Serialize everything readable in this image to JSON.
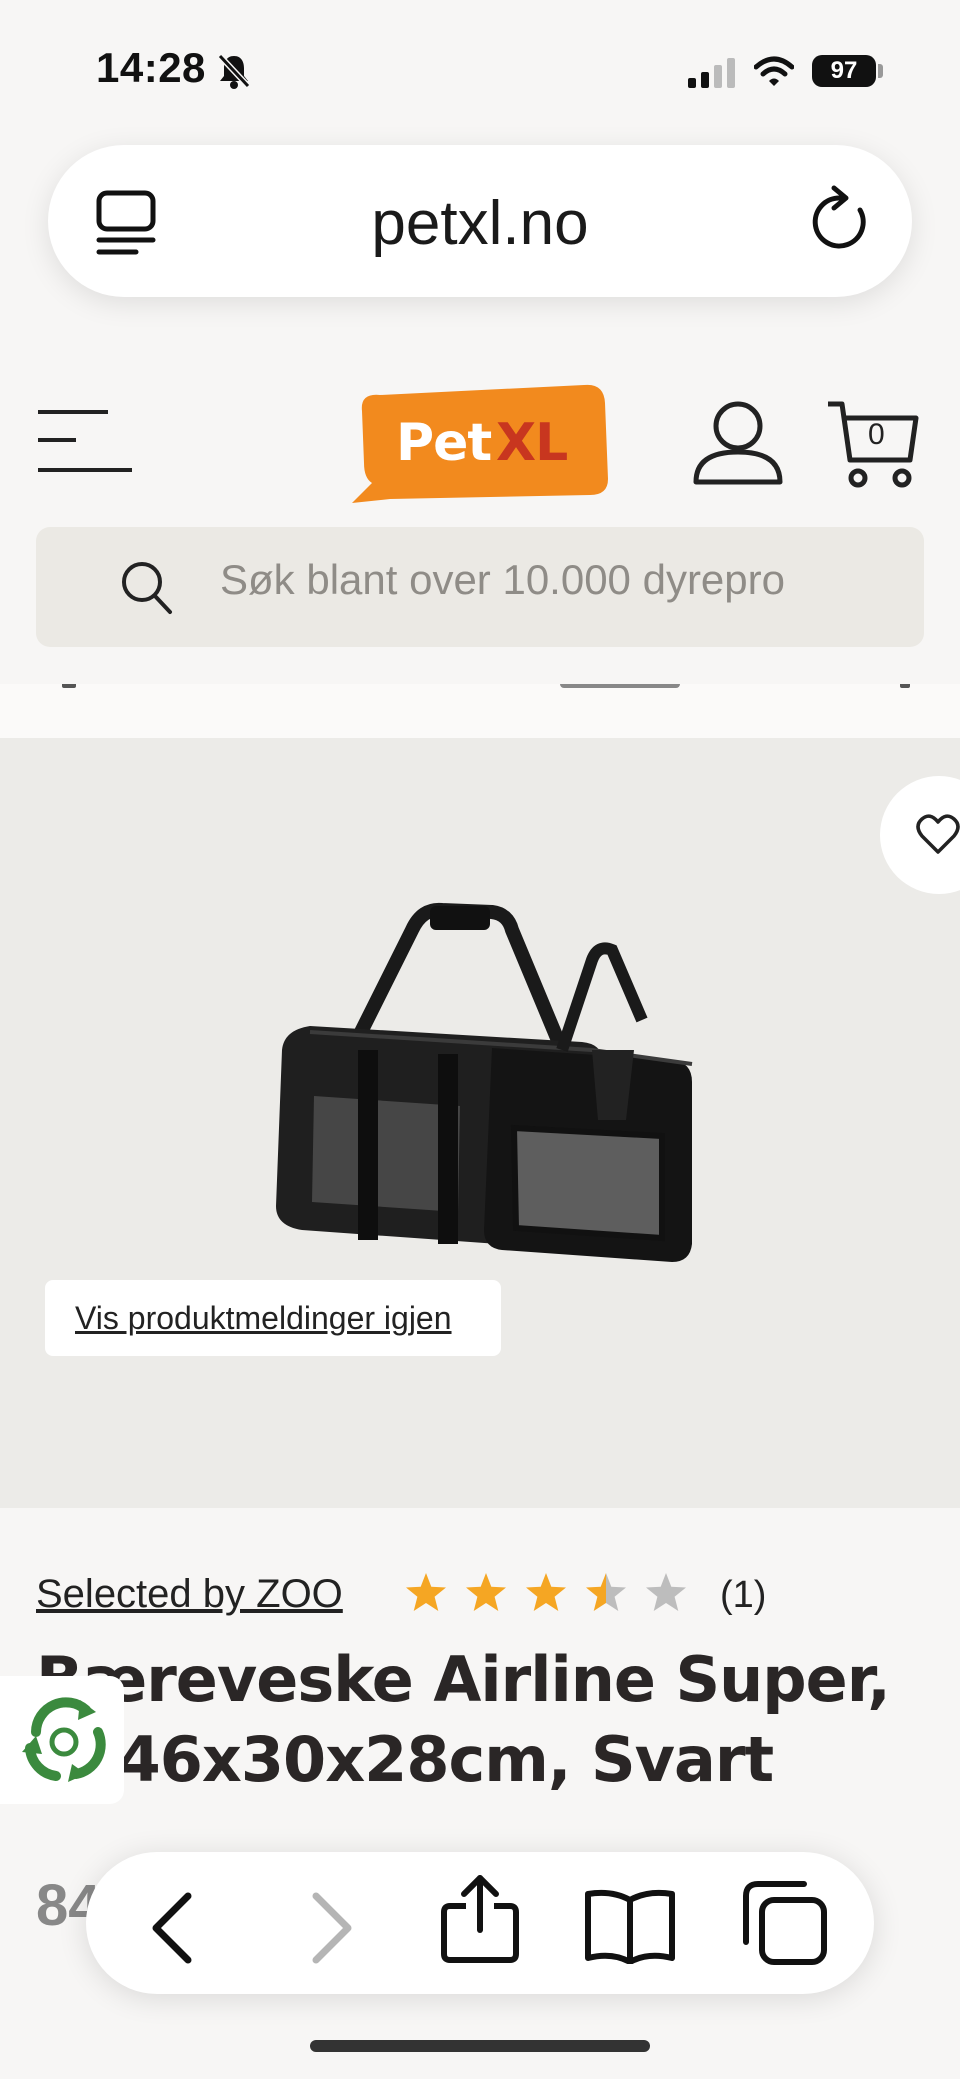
{
  "status_bar": {
    "time": "14:28",
    "battery": "97",
    "icons": [
      "bell-slash-icon",
      "signal-icon",
      "wifi-icon",
      "battery-icon"
    ]
  },
  "browser": {
    "url": "petxl.no",
    "icons": [
      "reader-icon",
      "reload-icon",
      "back-icon",
      "forward-icon",
      "share-icon",
      "bookmarks-icon",
      "tabs-icon"
    ]
  },
  "header": {
    "logo_text_1": "Pet",
    "logo_text_2": "XL",
    "cart_count": "0",
    "colors": {
      "brand_orange": "#f28a1e",
      "brand_red": "#c8361f"
    }
  },
  "search": {
    "placeholder": "Søk blant over 10.000 dyrepro"
  },
  "product": {
    "notice_link": "Vis produktmeldinger igjen",
    "brand": "Selected by ZOO",
    "rating": 3.5,
    "rating_max": 5,
    "review_count": "(1)",
    "title": "Bæreveske Airline Super, L, 46x30x28cm, Svart",
    "price": "84",
    "colors": {
      "star": "#f5a623",
      "star_empty": "#bdbdbd"
    }
  }
}
